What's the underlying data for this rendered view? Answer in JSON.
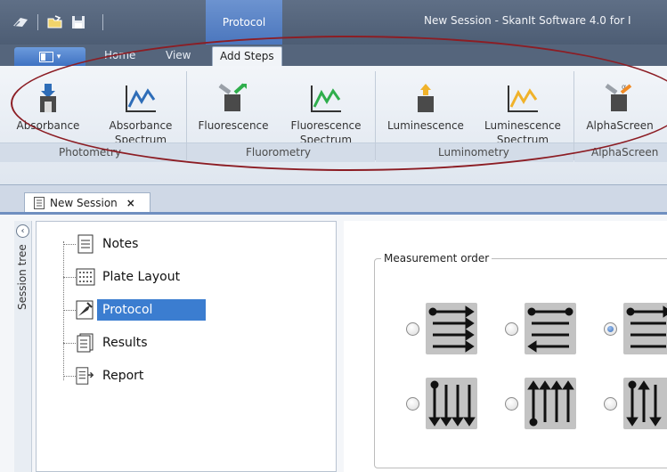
{
  "window": {
    "title": "New Session - SkanIt Software 4.0 for I",
    "contextual_tab": "Protocol"
  },
  "ribbon_tabs": [
    {
      "label": "Home",
      "active": false
    },
    {
      "label": "View",
      "active": false
    },
    {
      "label": "Add Steps",
      "active": true
    }
  ],
  "ribbon_buttons": [
    {
      "line1": "Absorbance",
      "line2": "",
      "icon": "absorbance-icon"
    },
    {
      "line1": "Absorbance",
      "line2": "Spectrum",
      "icon": "absorbance-spectrum-icon"
    },
    {
      "line1": "Fluorescence",
      "line2": "",
      "icon": "fluorescence-icon"
    },
    {
      "line1": "Fluorescence",
      "line2": "Spectrum",
      "icon": "fluorescence-spectrum-icon"
    },
    {
      "line1": "Luminescence",
      "line2": "",
      "icon": "luminescence-icon"
    },
    {
      "line1": "Luminescence",
      "line2": "Spectrum",
      "icon": "luminescence-spectrum-icon"
    },
    {
      "line1": "AlphaScreen",
      "line2": "",
      "icon": "alphascreen-icon"
    }
  ],
  "ribbon_groups": [
    "Photometry",
    "Fluorometry",
    "Luminometry",
    "AlphaScreen"
  ],
  "document_tab": {
    "label": "New Session",
    "close": "×"
  },
  "sidebar": {
    "label": "Session tree",
    "collapse": "‹"
  },
  "tree_items": [
    {
      "label": "Notes",
      "icon": "notes-icon",
      "selected": false
    },
    {
      "label": "Plate Layout",
      "icon": "plate-layout-icon",
      "selected": false
    },
    {
      "label": "Protocol",
      "icon": "protocol-icon",
      "selected": true
    },
    {
      "label": "Results",
      "icon": "results-icon",
      "selected": false
    },
    {
      "label": "Report",
      "icon": "report-icon",
      "selected": false
    }
  ],
  "measurement_order": {
    "label": "Measurement order",
    "selected_index": 2,
    "options": [
      "rows-left-right",
      "rows-serpentine",
      "rows-return",
      "columns-down",
      "columns-up",
      "columns-serpentine"
    ]
  },
  "colors": {
    "accent": "#3b7dd0",
    "annotation_ellipse": "#8c1d24",
    "title_bar": "#55657c"
  }
}
